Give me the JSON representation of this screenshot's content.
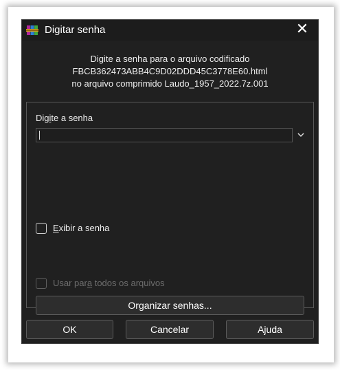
{
  "window": {
    "title": "Digitar senha",
    "close_glyph": "✕"
  },
  "info": {
    "line1": "Digite a senha para o arquivo codificado",
    "line2": "FBCB362473ABB4C9D02DDD45C3778E60.html",
    "line3": "no arquivo comprimido Laudo_1957_2022.7z.001"
  },
  "password": {
    "label_pre": "Dig",
    "label_key": "i",
    "label_post": "te a senha",
    "value": ""
  },
  "show_password": {
    "key": "E",
    "label_post": "xibir a senha",
    "checked": false
  },
  "use_for_all": {
    "label_pre": "Usar par",
    "label_key": "a",
    "label_post": " todos os arquivos",
    "checked": false,
    "enabled": false
  },
  "buttons": {
    "organize": "Organizar senhas...",
    "ok": "OK",
    "cancel": "Cancelar",
    "help": "Ajuda"
  },
  "icons": {
    "app": "winrar-books-icon",
    "close": "close-icon",
    "dropdown": "chevron-down-icon"
  },
  "colors": {
    "background": "#202020",
    "button": "#2d2d2d",
    "border": "#5c5c5c",
    "text": "#eeeeee",
    "disabled_text": "#6e6e6e"
  }
}
